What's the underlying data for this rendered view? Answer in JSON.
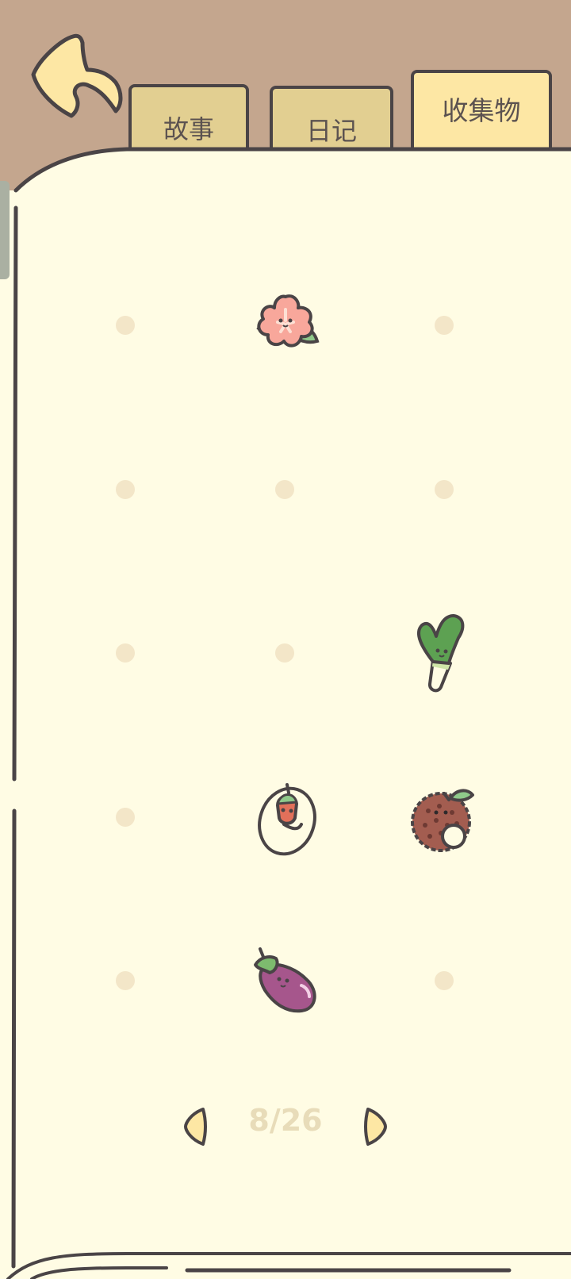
{
  "tabs": [
    {
      "label": "故事",
      "selected": false
    },
    {
      "label": "日记",
      "selected": false
    },
    {
      "label": "收集物",
      "selected": true
    }
  ],
  "grid": {
    "columns": 3,
    "rows": 5,
    "cells": [
      {
        "item": "empty"
      },
      {
        "item": "flower-icon"
      },
      {
        "item": "empty"
      },
      {
        "item": "empty"
      },
      {
        "item": "empty"
      },
      {
        "item": "empty"
      },
      {
        "item": "empty"
      },
      {
        "item": "empty"
      },
      {
        "item": "leek-icon"
      },
      {
        "item": "empty"
      },
      {
        "item": "seed-icon"
      },
      {
        "item": "lychee-icon"
      },
      {
        "item": "empty"
      },
      {
        "item": "eggplant-icon"
      },
      {
        "item": "empty"
      }
    ]
  },
  "pager": {
    "current": 8,
    "total": 26,
    "label": "8/26"
  },
  "colors": {
    "background": "#c4a68e",
    "page": "#fffce4",
    "outline": "#4a4446",
    "tab_inactive": "#e2cf91",
    "tab_active": "#fde7a4",
    "empty_slot": "#f3e6c8",
    "page_counter": "#e8dcb9"
  }
}
